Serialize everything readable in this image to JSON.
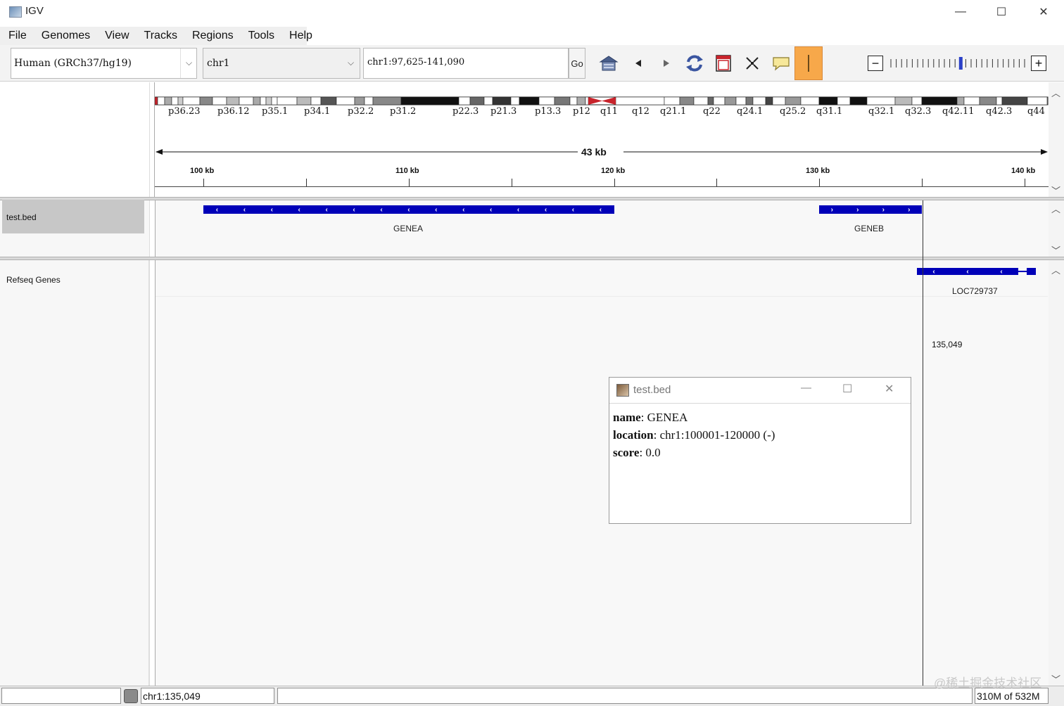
{
  "window": {
    "title": "IGV",
    "minimize_glyph": "—",
    "maximize_glyph": "☐",
    "close_glyph": "✕"
  },
  "menu": [
    "File",
    "Genomes",
    "View",
    "Tracks",
    "Regions",
    "Tools",
    "Help"
  ],
  "toolbar": {
    "genome": "Human (GRCh37/hg19)",
    "chromosome": "chr1",
    "locus": "chr1:97,625-141,090",
    "go_label": "Go",
    "icons": [
      "home-icon",
      "back-arrow-icon",
      "forward-arrow-icon",
      "refresh-icon",
      "region-of-interest-icon",
      "fit-to-window-icon",
      "popup-info-icon",
      "ruler-line-icon"
    ],
    "zoom_out": "−",
    "zoom_in": "+",
    "zoom_level_fraction": 0.52
  },
  "ideogram": {
    "bands": [
      "p36.23",
      "p36.12",
      "p35.1",
      "p34.1",
      "p32.2",
      "p31.2",
      "p22.3",
      "p21.3",
      "p13.3",
      "p12",
      "q11",
      "q12",
      "q21.1",
      "q22",
      "q24.1",
      "q25.2",
      "q31.1",
      "q32.1",
      "q32.3",
      "q42.11",
      "q42.3",
      "q44"
    ]
  },
  "ruler": {
    "span_label": "43 kb",
    "ticks": [
      "100 kb",
      "110 kb",
      "120 kb",
      "130 kb",
      "140 kb"
    ]
  },
  "tracks": [
    {
      "name": "test.bed",
      "features": [
        {
          "name": "GENEA",
          "strand": "-",
          "start": 100001,
          "end": 120000
        },
        {
          "name": "GENEB",
          "strand": "+",
          "start": 130001,
          "end": 135000
        }
      ]
    },
    {
      "name": "Refseq Genes",
      "features": [
        {
          "name": "LOC729737",
          "strand": "-"
        }
      ]
    }
  ],
  "cursor": {
    "position_label": "135,049"
  },
  "popup": {
    "title": "test.bed",
    "rows": [
      {
        "key": "name",
        "value": ": GENEA"
      },
      {
        "key": "location",
        "value": ": chr1:100001-120000 (-)"
      },
      {
        "key": "score",
        "value": ": 0.0"
      }
    ]
  },
  "status": {
    "locus": "chr1:135,049",
    "memory": "310M of 532M"
  },
  "watermark": "@稀土掘金技术社区"
}
